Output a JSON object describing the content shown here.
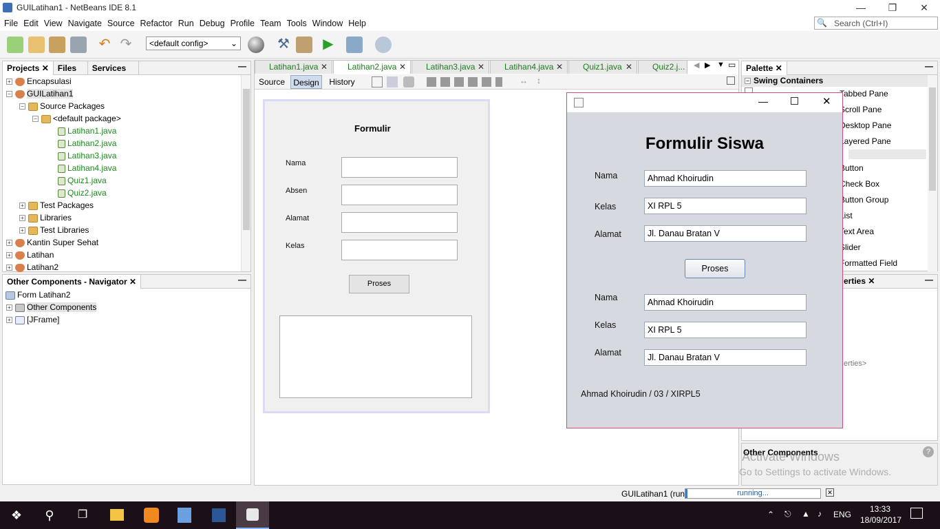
{
  "window": {
    "title": "GUILatihan1 - NetBeans IDE 8.1"
  },
  "menu": [
    "File",
    "Edit",
    "View",
    "Navigate",
    "Source",
    "Refactor",
    "Run",
    "Debug",
    "Profile",
    "Team",
    "Tools",
    "Window",
    "Help"
  ],
  "search": {
    "placeholder": "Search (Ctrl+I)"
  },
  "toolbar": {
    "config": "<default config>"
  },
  "projects": {
    "tabs": [
      "Projects",
      "Files",
      "Services"
    ],
    "items": [
      {
        "label": "Encapsulasi"
      },
      {
        "label": "GUILatihan1"
      },
      {
        "label": "Source Packages"
      },
      {
        "label": "<default package>"
      },
      {
        "label": "Latihan1.java"
      },
      {
        "label": "Latihan2.java"
      },
      {
        "label": "Latihan3.java"
      },
      {
        "label": "Latihan4.java"
      },
      {
        "label": "Quiz1.java"
      },
      {
        "label": "Quiz2.java"
      },
      {
        "label": "Test Packages"
      },
      {
        "label": "Libraries"
      },
      {
        "label": "Test Libraries"
      },
      {
        "label": "Kantin Super Sehat"
      },
      {
        "label": "Latihan"
      },
      {
        "label": "Latihan2"
      }
    ]
  },
  "navigator": {
    "title": "Other Components - Navigator",
    "items": [
      "Form Latihan2",
      "Other Components",
      "[JFrame]"
    ]
  },
  "editor": {
    "tabs": [
      "Latihan1.java",
      "Latihan2.java",
      "Latihan3.java",
      "Latihan4.java",
      "Quiz1.java",
      "Quiz2.j..."
    ],
    "subtabs": [
      "Source",
      "Design",
      "History"
    ]
  },
  "form": {
    "title": "Formulir",
    "labels": [
      "Nama",
      "Absen",
      "Alamat",
      "Kelas"
    ],
    "button": "Proses"
  },
  "palette": {
    "title": "Palette",
    "section": "Swing Containers",
    "items": [
      "Tabbed Pane",
      "Scroll Pane",
      "Desktop Pane",
      "Layered Pane",
      "Button",
      "Check Box",
      "Button Group",
      "List",
      "Text Area",
      "Slider",
      "Formatted Field"
    ]
  },
  "properties": {
    "title": "erties",
    "placeholder": "erties>",
    "footer": "Other Components"
  },
  "watermark": {
    "line1": "Activate Windows",
    "line2": "Go to Settings to activate Windows."
  },
  "dialog": {
    "title": "Formulir Siswa",
    "labels": [
      "Nama",
      "Kelas",
      "Alamat"
    ],
    "values": [
      "Ahmad Khoirudin",
      "XI RPL 5",
      "Jl. Danau Bratan V"
    ],
    "button": "Proses",
    "out_labels": [
      "Nama",
      "Kelas",
      "Alamat"
    ],
    "out_values": [
      "Ahmad Khoirudin",
      "XI RPL 5",
      "Jl. Danau Bratan V"
    ],
    "summary": "Ahmad Khoirudin / 03 / XIRPL5"
  },
  "status": {
    "project": "GUILatihan1 (run)",
    "progress": "running..."
  },
  "taskbar": {
    "lang": "ENG",
    "time": "13:33",
    "date": "18/09/2017"
  }
}
